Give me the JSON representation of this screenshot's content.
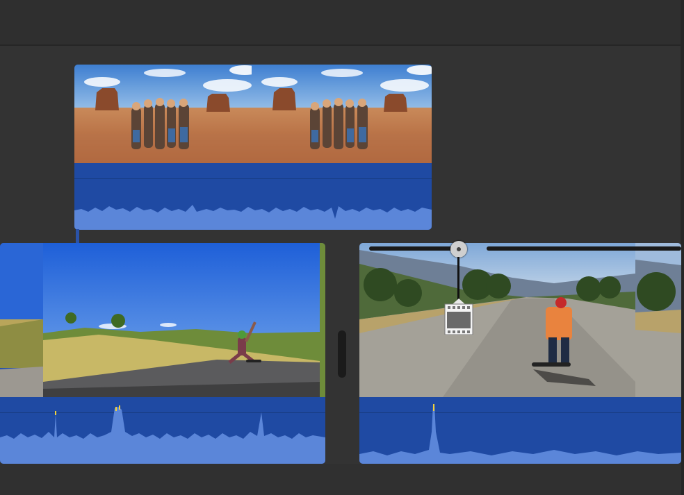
{
  "timeline": {
    "connected_clip": {
      "name": "monument-valley-group-photo",
      "frames": 2,
      "accent": "#2551a8"
    },
    "primary_clip_left": {
      "name": "skateboarder-hillside",
      "accent": "#2551a8"
    },
    "primary_clip_right": {
      "name": "skateboarder-road",
      "accent": "#2551a8"
    },
    "icons": {
      "skimmer": "skimmer-icon",
      "transition": "film-frame-icon",
      "trim": "trim-handle-icon"
    },
    "colors": {
      "background": "#333333",
      "clip_blue": "#2551a8",
      "audio_blue": "#1f4aa3",
      "waveform": "#5b86d9",
      "peak": "#f3d23a"
    }
  }
}
